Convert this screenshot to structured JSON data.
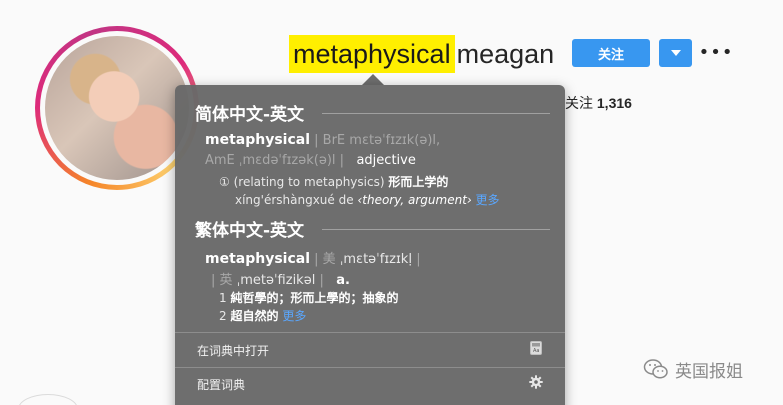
{
  "profile": {
    "username_highlight": "metaphysical",
    "username_rest": "meagan",
    "follow_label": "关注",
    "more_label": "•••",
    "stats_label": "关注",
    "stats_value": "1,316"
  },
  "dictionary": {
    "sections": [
      {
        "title": "简体中文-英文",
        "headword": "metaphysical",
        "pron_sep1": "| BrE",
        "pron_bre": "mɛtəˈfɪzɪk(ə)l,",
        "pron_ame_label": "AmE",
        "pron_ame": "ˌmɛdəˈfɪzək(ə)l",
        "pron_sep2": "|",
        "pos": "adjective",
        "sense_num": "①",
        "sense_text": "(relating to metaphysics)",
        "sense_cn": "形而上学的",
        "pinyin": "xíng'érshàngxué de",
        "example": "‹theory, argument›",
        "more": "更多"
      },
      {
        "title": "繁体中文-英文",
        "headword": "metaphysical",
        "pron_sep1": "| 美",
        "pron_us": "ˌmɛtəˈfɪzɪkḷ",
        "pron_sep2": "|",
        "pron_uk_label": "| 英",
        "pron_uk": "ˌmetəˈfizikəl",
        "pron_sep3": "|",
        "pos": "a.",
        "def1_num": "1",
        "def1": "純哲學的；形而上學的；抽象的",
        "def2_num": "2",
        "def2": "超自然的",
        "more": "更多"
      }
    ],
    "footer": {
      "open_label": "在词典中打开",
      "config_label": "配置词典"
    }
  },
  "watermark": {
    "text": "英国报姐"
  },
  "colors": {
    "follow_blue": "#3897f0",
    "highlight_yellow": "#ffef00",
    "popover_bg": "#686868",
    "link_blue": "#5aa7ff"
  },
  "icons": [
    "chevron-down-icon",
    "more-dots-icon",
    "dictionary-book-icon",
    "gear-icon",
    "wechat-logo-icon"
  ]
}
